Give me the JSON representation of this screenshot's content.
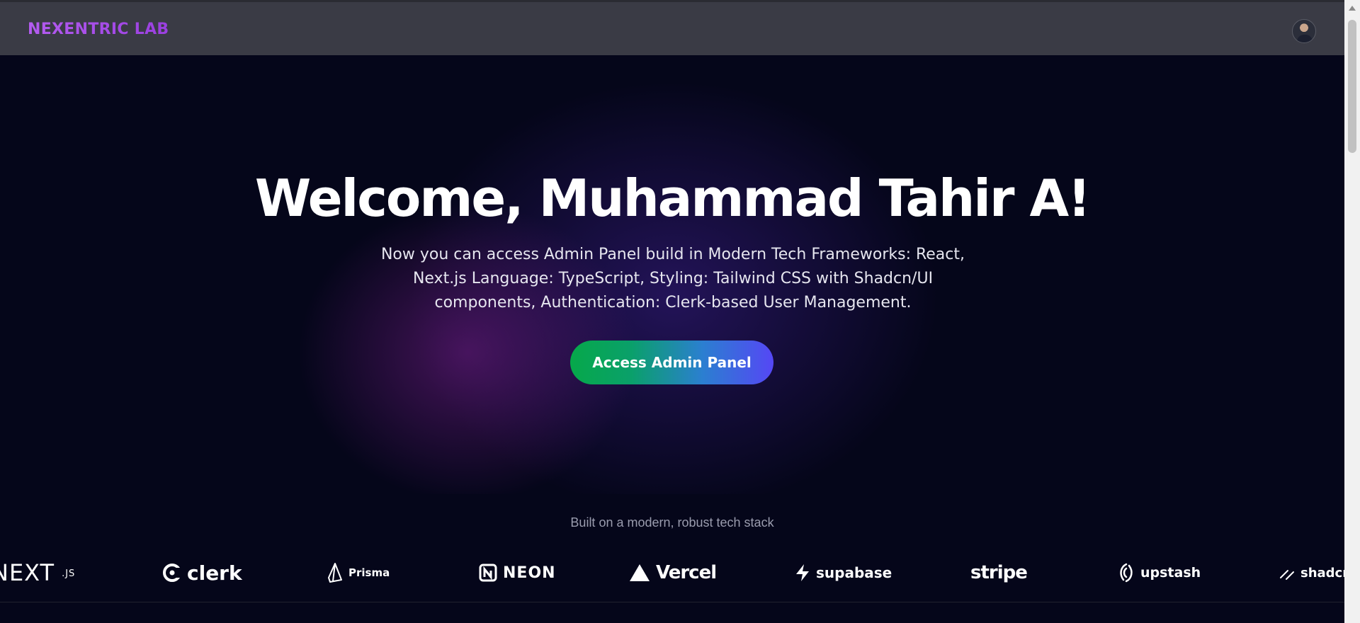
{
  "header": {
    "brand": "NEXENTRIC LAB",
    "avatar_icon": "user-avatar"
  },
  "hero": {
    "title": "Welcome, Muhammad Tahir A!",
    "subtitle": "Now you can access Admin Panel build in Modern Tech Frameworks: React, Next.js Language: TypeScript, Styling: Tailwind CSS with Shadcn/UI components, Authentication: Clerk-based User Management.",
    "cta_label": "Access Admin Panel"
  },
  "tech_stack": {
    "title": "Built on a modern, robust tech stack",
    "logos": [
      {
        "label": "NEXT",
        "suffix": ".JS"
      },
      {
        "label": "clerk"
      },
      {
        "label": "Prisma"
      },
      {
        "label": "NEON"
      },
      {
        "label": "Vercel"
      },
      {
        "label": "supabase"
      },
      {
        "label": "stripe"
      },
      {
        "label": "upstash"
      },
      {
        "label": "shadcn"
      }
    ]
  },
  "colors": {
    "brand_gradient": [
      "#b45cf0",
      "#9a3fe0"
    ],
    "cta_gradient": [
      "#06a84a",
      "#5547f5"
    ],
    "background": "#05061a",
    "topbar": "#3a3b45"
  }
}
